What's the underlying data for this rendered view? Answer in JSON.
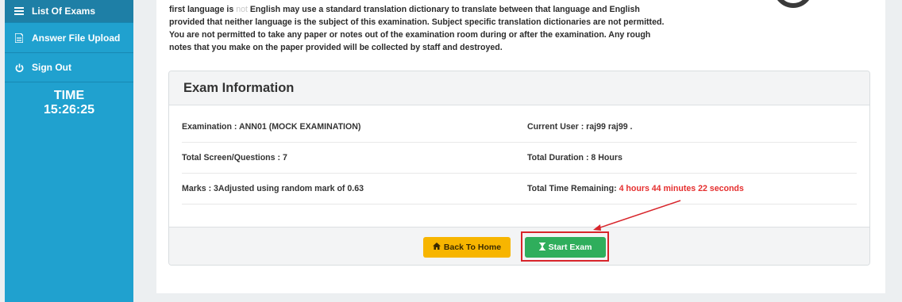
{
  "sidebar": {
    "items": [
      {
        "label": "List Of Exams",
        "icon": "list-icon"
      },
      {
        "label": "Answer File Upload",
        "icon": "file-upload-icon"
      },
      {
        "label": "Sign Out",
        "icon": "power-icon"
      }
    ],
    "time_label": "TIME",
    "time_value": "15:26:25"
  },
  "instructions": {
    "line1_a": "first language is ",
    "line1_not": "not",
    "line1_b": " English may use a standard translation dictionary to translate between that language and English",
    "line2": "provided that neither language is the subject of this examination. Subject specific translation dictionaries are not permitted.",
    "line3": "You are not permitted to take any paper or notes out of the examination room during or after the examination. Any rough",
    "line4": "notes that you make on the paper provided will be collected by staff and destroyed."
  },
  "exam_info": {
    "title": "Exam Information",
    "examination": "Examination : ANN01 (MOCK EXAMINATION)",
    "current_user": "Current User : raj99 raj99 .",
    "total_questions": "Total Screen/Questions : 7",
    "total_duration": "Total Duration : 8 Hours",
    "marks": "Marks : 3Adjusted using random mark of 0.63",
    "time_remaining_label": "Total Time Remaining: ",
    "time_remaining_value": "4 hours 44 minutes 22 seconds"
  },
  "buttons": {
    "back_home": "Back To Home",
    "start_exam": "Start Exam"
  },
  "colors": {
    "sidebar": "#20a1cf",
    "start_button": "#2fae5c",
    "home_button": "#f7b500",
    "highlight": "#d8252b",
    "time_remaining": "#e52e2e"
  }
}
